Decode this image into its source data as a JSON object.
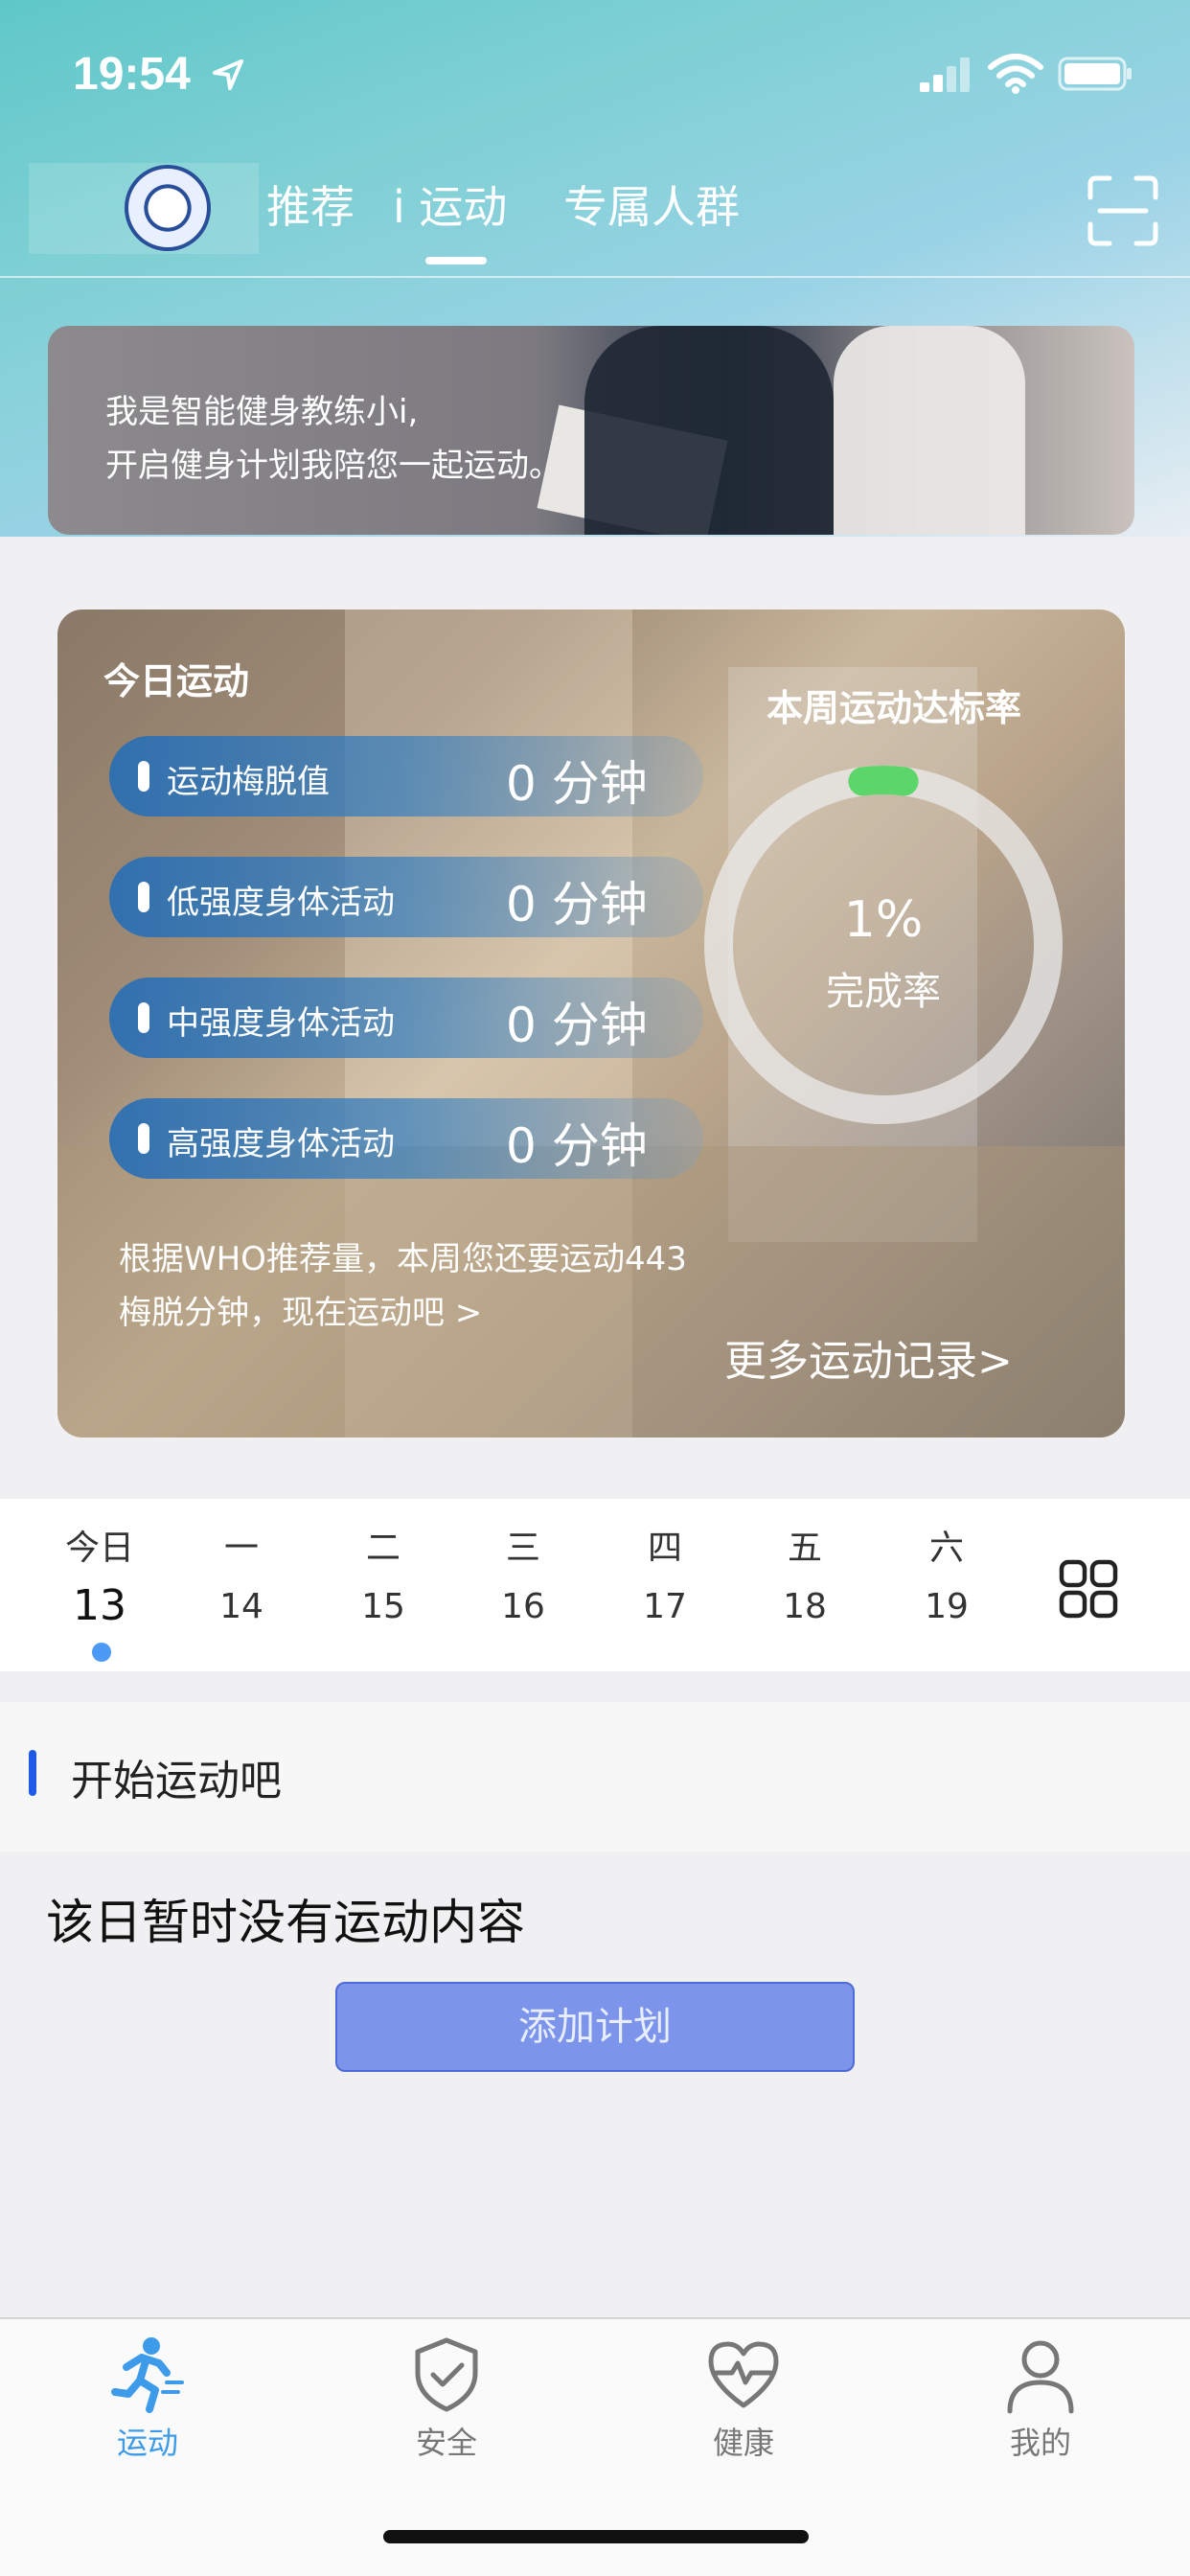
{
  "status": {
    "time": "19:54"
  },
  "nav": {
    "tabs": [
      {
        "label": "推荐"
      },
      {
        "label": "i 运动"
      },
      {
        "label": "专属人群"
      }
    ]
  },
  "banner": {
    "line1": "我是智能健身教练小i,",
    "line2": "开启健身计划我陪您一起运动。"
  },
  "today": {
    "title": "今日运动",
    "rate_title": "本周运动达标率",
    "completion_pct": "1%",
    "completion_label": "完成率",
    "completion_value": 0.01,
    "metrics": [
      {
        "label": "运动梅脱值",
        "value": "0 分钟"
      },
      {
        "label": "低强度身体活动",
        "value": "0 分钟"
      },
      {
        "label": "中强度身体活动",
        "value": "0 分钟"
      },
      {
        "label": "高强度身体活动",
        "value": "0 分钟"
      }
    ],
    "advice_line1": "根据WHO推荐量，本周您还要运动443",
    "advice_line2": "梅脱分钟，现在运动吧 >",
    "more_records": "更多运动记录>"
  },
  "week": {
    "days": [
      {
        "name": "今日",
        "num": "13"
      },
      {
        "name": "一",
        "num": "14"
      },
      {
        "name": "二",
        "num": "15"
      },
      {
        "name": "三",
        "num": "16"
      },
      {
        "name": "四",
        "num": "17"
      },
      {
        "name": "五",
        "num": "18"
      },
      {
        "name": "六",
        "num": "19"
      }
    ]
  },
  "section": {
    "title": "开始运动吧"
  },
  "empty": {
    "text": "该日暂时没有运动内容",
    "button": "添加计划"
  },
  "tabbar": {
    "items": [
      {
        "label": "运动",
        "icon": "running-icon"
      },
      {
        "label": "安全",
        "icon": "shield-check-icon"
      },
      {
        "label": "健康",
        "icon": "heart-pulse-icon"
      },
      {
        "label": "我的",
        "icon": "person-icon"
      }
    ]
  },
  "colors": {
    "accent": "#3d9be9",
    "button": "#7c95eb",
    "ring_progress": "#5cd66a"
  }
}
